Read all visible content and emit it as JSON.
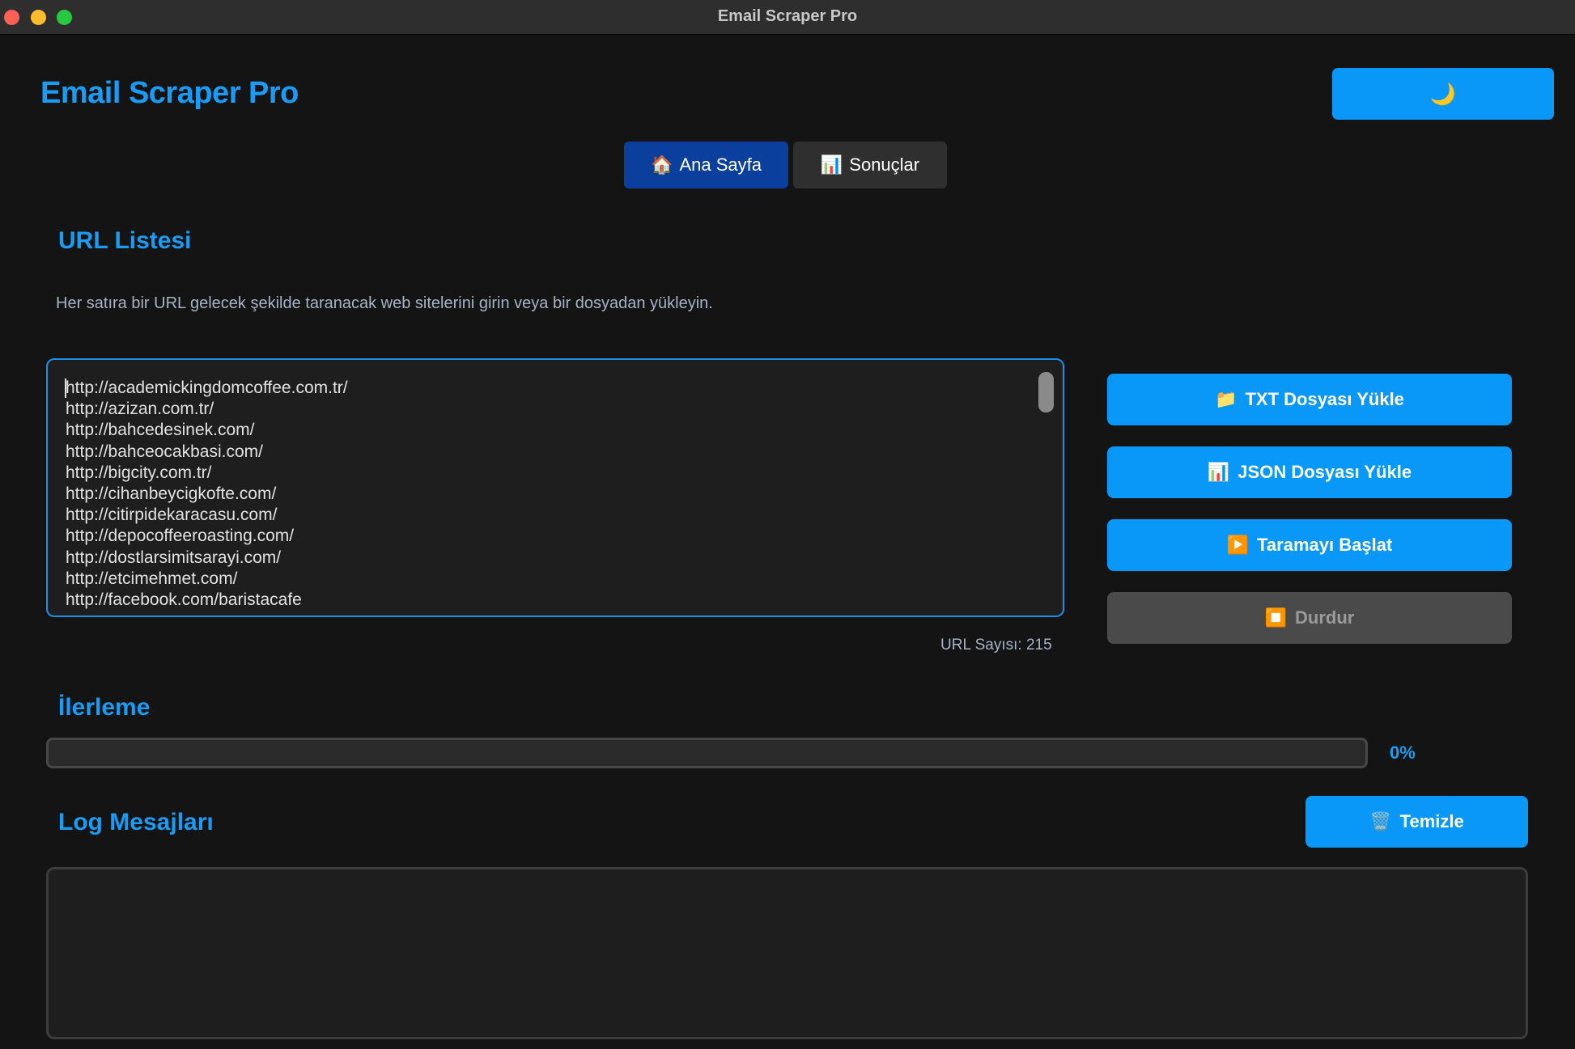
{
  "window": {
    "title": "Email Scraper Pro"
  },
  "header": {
    "app_title": "Email Scraper Pro",
    "theme_toggle_icon": "moon-icon",
    "theme_toggle_glyph": "🌙"
  },
  "tabs": [
    {
      "label": "Ana Sayfa",
      "icon": "house-icon",
      "glyph": "🏠",
      "active": true
    },
    {
      "label": "Sonuçlar",
      "icon": "chart-icon",
      "glyph": "📊",
      "active": false
    }
  ],
  "url_section": {
    "title": "URL Listesi",
    "description": "Her satıra bir URL gelecek şekilde taranacak web sitelerini girin veya bir dosyadan yükleyin.",
    "urls": [
      "http://academickingdomcoffee.com.tr/",
      "http://azizan.com.tr/",
      "http://bahcedesinek.com/",
      "http://bahceocakbasi.com/",
      "http://bigcity.com.tr/",
      "http://cihanbeycigkofte.com/",
      "http://citirpidekaracasu.com/",
      "http://depocoffeeroasting.com/",
      "http://dostlarsimitsarayi.com/",
      "http://etcimehmet.com/",
      "http://facebook.com/baristacafe"
    ],
    "url_count_text": "URL Sayısı: 215"
  },
  "actions": {
    "load_txt": {
      "label": "TXT Dosyası Yükle",
      "icon": "folder-icon",
      "glyph": "📁"
    },
    "load_json": {
      "label": "JSON Dosyası Yükle",
      "icon": "chart-icon",
      "glyph": "📊"
    },
    "start_scan": {
      "label": "Taramayı Başlat",
      "icon": "play-icon",
      "glyph": "▶️"
    },
    "stop": {
      "label": "Durdur",
      "icon": "stop-icon",
      "glyph": "⏹️",
      "enabled": false
    }
  },
  "progress": {
    "title": "İlerleme",
    "value": 0,
    "percent_text": "0%"
  },
  "log": {
    "title": "Log Mesajları",
    "clear_label": "Temizle",
    "clear_icon": "trash-icon",
    "clear_glyph": "🗑️",
    "messages": ""
  },
  "colors": {
    "accent": "#0a98f8",
    "accent_text": "#1a9cf5",
    "active_tab": "#0a3f9e",
    "background": "#141414",
    "panel": "#1e1e1e",
    "disabled": "#4a4a4a"
  }
}
